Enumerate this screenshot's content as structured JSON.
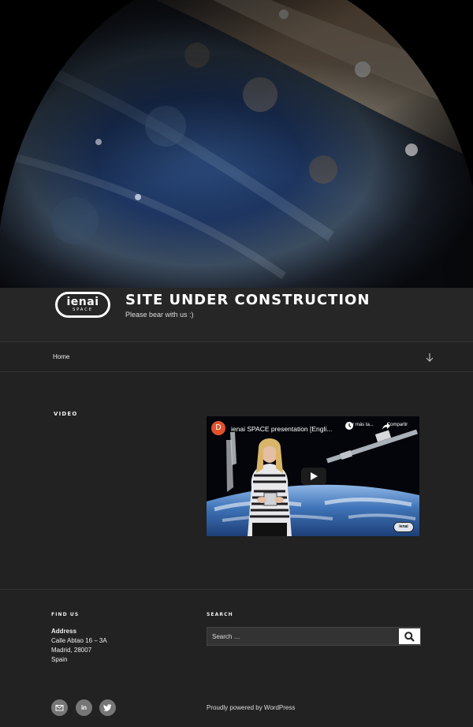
{
  "branding": {
    "logo_text": "ienai",
    "logo_subtext": "SPACE",
    "site_title": "SITE UNDER CONSTRUCTION",
    "site_description": "Please bear with us :)"
  },
  "nav": {
    "items": [
      {
        "label": "Home"
      }
    ],
    "scroll_icon": "arrow-down-icon"
  },
  "content": {
    "section_title": "VIDEO",
    "video": {
      "channel_initial": "D",
      "title": "ienai SPACE presentation [Engli...",
      "watch_later_label": "Ver más ta...",
      "share_label": "Compartir",
      "badge_text": "ienai",
      "play_icon": "play-icon"
    }
  },
  "footer": {
    "find_us": {
      "title": "FIND US",
      "address_label": "Address",
      "address_lines": [
        "Calle Abtao 16 – 3A",
        "Madrid, 28007",
        "Spain"
      ]
    },
    "search": {
      "title": "SEARCH",
      "placeholder": "Search …",
      "button_icon": "search-icon"
    },
    "social": [
      {
        "icon": "email-icon",
        "label": ""
      },
      {
        "icon": "linkedin-icon",
        "label": "in"
      },
      {
        "icon": "twitter-icon",
        "label": ""
      }
    ],
    "powered_by": "Proudly powered by WordPress"
  },
  "colors": {
    "background": "#222222",
    "branding_bg": "#262626",
    "social_bg": "#767676",
    "channel_avatar": "#e3512a"
  }
}
